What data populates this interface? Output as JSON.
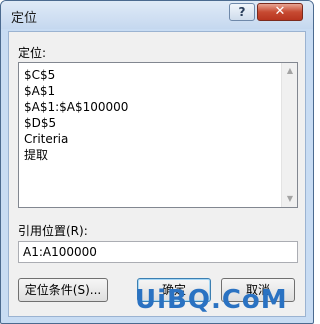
{
  "window": {
    "title": "定位",
    "help_label": "?",
    "close_label": "✕"
  },
  "goto": {
    "label": "定位:",
    "items": [
      "$C$5",
      "$A$1",
      "$A$1:$A$100000",
      "$D$5",
      "Criteria",
      "提取"
    ]
  },
  "reference": {
    "label": "引用位置(R):",
    "value": "A1:A100000"
  },
  "buttons": {
    "special": "定位条件(S)...",
    "ok": "确定",
    "cancel": "取消"
  },
  "watermark": "UiBQ.CoM",
  "icons": {
    "scroll_up": "scroll-up-arrow-icon",
    "scroll_down": "scroll-down-arrow-icon"
  }
}
